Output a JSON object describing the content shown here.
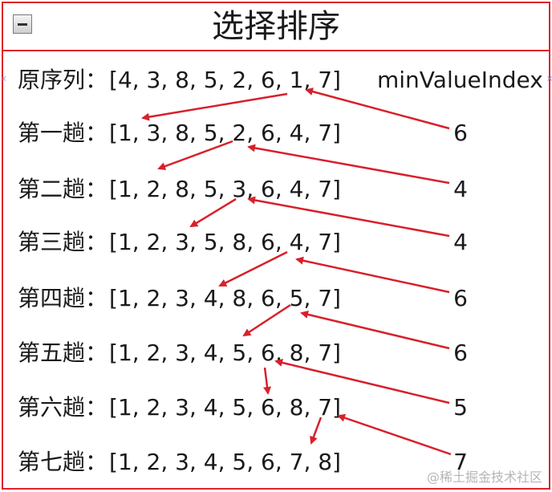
{
  "title": "选择排序",
  "header": {
    "col_label": "minValueIndex"
  },
  "rows": [
    {
      "label": "原序列：",
      "array": "[4, 3, 8, 5, 2, 6, 1, 7]",
      "min_index": ""
    },
    {
      "label": "第一趟：",
      "array": "[1, 3, 8, 5, 2, 6, 4, 7]",
      "min_index": "6"
    },
    {
      "label": "第二趟：",
      "array": "[1, 2, 8, 5, 3, 6, 4, 7]",
      "min_index": "4"
    },
    {
      "label": "第三趟：",
      "array": "[1, 2, 3, 5, 8, 6, 4, 7]",
      "min_index": "4"
    },
    {
      "label": "第四趟：",
      "array": "[1, 2, 3, 4, 8, 6, 5, 7]",
      "min_index": "6"
    },
    {
      "label": "第五趟：",
      "array": "[1, 2, 3, 4, 5, 6, 8, 7]",
      "min_index": "6"
    },
    {
      "label": "第六趟：",
      "array": "[1, 2, 3, 4, 5, 6, 8, 7]",
      "min_index": "5"
    },
    {
      "label": "第七趟：",
      "array": "[1, 2, 3, 4, 5, 6, 7, 8]",
      "min_index": "7"
    }
  ],
  "watermark": "@稀土掘金技术社区",
  "colors": {
    "frame": "#e0202a",
    "arrow": "#d8202a",
    "text": "#1a1a1a"
  },
  "icons": {
    "collapse": "collapse-minus-icon"
  }
}
